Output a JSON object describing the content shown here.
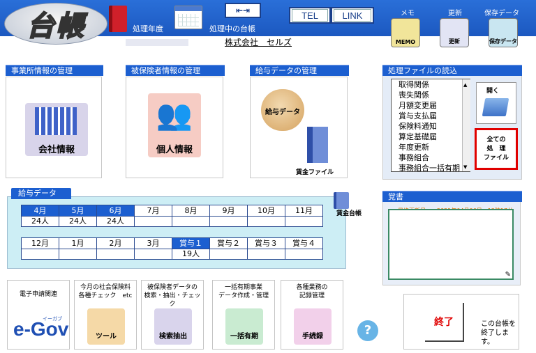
{
  "header": {
    "logo": "台帳",
    "year_label": "処理年度",
    "current_ledger_label": "処理中の台帳",
    "company": "株式会社　セルズ",
    "tel": "TEL",
    "link": "LINK",
    "memo_label": "メモ",
    "memo_icon_text": "MEMO",
    "update_label": "更新",
    "update_icon_text": "更新",
    "save_label": "保存データ",
    "save_icon_text": "保存データ"
  },
  "panels": {
    "office": {
      "title": "事業所情報の管理",
      "button": "会社情報"
    },
    "insured": {
      "title": "被保険者情報の管理",
      "button": "個人情報"
    },
    "salary_mgmt": {
      "title": "給与データの管理",
      "salary_button": "給与データ",
      "wage_file": "賃金ファイル"
    },
    "process_file": {
      "title": "処理ファイルの読込",
      "items": [
        "取得関係",
        "喪失関係",
        "月額変更届",
        "賞与支払届",
        "保険料通知",
        "算定基礎届",
        "年度更新",
        "事務組合",
        "事務組合一括有期"
      ],
      "open_label": "開く",
      "all_files": [
        "全ての",
        "処　理",
        "ファイル"
      ]
    }
  },
  "salary_data": {
    "title": "給与データ",
    "row1": [
      {
        "h": "4月",
        "v": "24人",
        "sel": true
      },
      {
        "h": "5月",
        "v": "24人",
        "sel": true
      },
      {
        "h": "6月",
        "v": "24人",
        "sel": true
      },
      {
        "h": "7月",
        "v": "",
        "sel": false
      },
      {
        "h": "8月",
        "v": "",
        "sel": false
      },
      {
        "h": "9月",
        "v": "",
        "sel": false
      },
      {
        "h": "10月",
        "v": "",
        "sel": false
      },
      {
        "h": "11月",
        "v": "",
        "sel": false
      }
    ],
    "row2": [
      {
        "h": "12月",
        "v": "",
        "sel": false
      },
      {
        "h": "1月",
        "v": "",
        "sel": false
      },
      {
        "h": "2月",
        "v": "",
        "sel": false
      },
      {
        "h": "3月",
        "v": "",
        "sel": false
      },
      {
        "h": "賞与１",
        "v": "19人",
        "sel": true
      },
      {
        "h": "賞与２",
        "v": "",
        "sel": false
      },
      {
        "h": "賞与３",
        "v": "",
        "sel": false
      },
      {
        "h": "賞与４",
        "v": "",
        "sel": false
      }
    ],
    "wage_ledger": "賃金台帳"
  },
  "notes": {
    "title": "覚書",
    "last_updated": "最終更新日　　2021年04月06日　13時17分"
  },
  "bottom": {
    "egov_title": "電子申請関連",
    "egov_logo": "e-Gov",
    "egov_kana": "イーガブ",
    "check_title": "今月の社会保険料\n各種チェック　etc",
    "check_icon": "ツール",
    "search_title": "被保険者データの\n検索・抽出・チェック",
    "search_icon": "検索抽出",
    "lump_title": "一括有期事業\nデータ作成・管理",
    "lump_icon": "一括有期",
    "procedure_title": "各種業務の\n記録管理",
    "procedure_icon": "手続録",
    "help": "?",
    "end_button": "終了",
    "end_text": "この台帳を\n終了します。"
  },
  "colors": {
    "accent": "#1c5fd0",
    "highlight_red": "#e00000",
    "salary_bg": "#cdeef5"
  }
}
